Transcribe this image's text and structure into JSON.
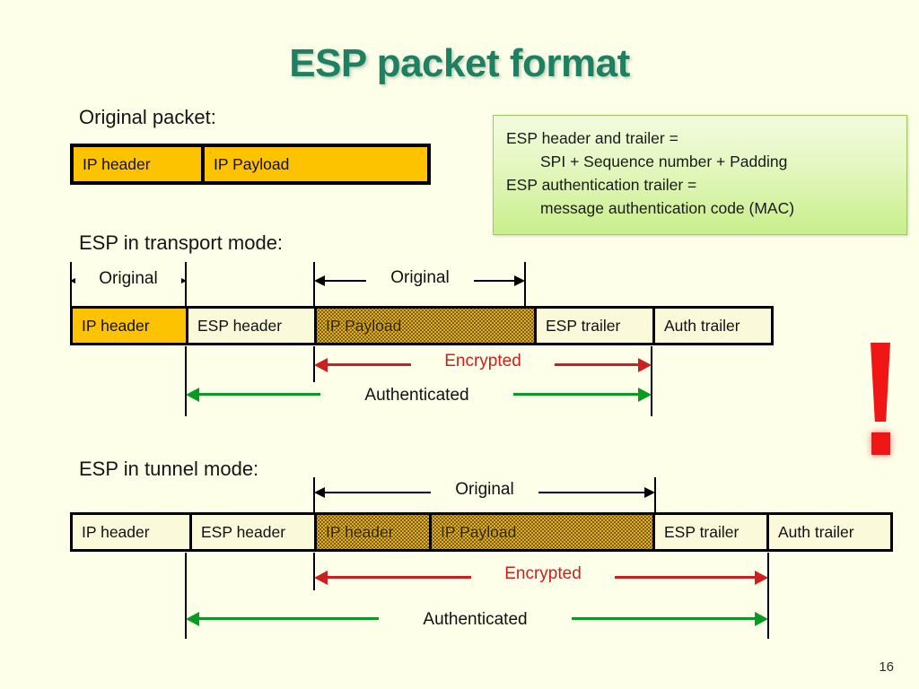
{
  "slide": {
    "title": "ESP packet format",
    "page_number": "16",
    "background_color": "#FDFFE9",
    "title_color": "#1E7F62"
  },
  "legend": {
    "lines": [
      "ESP header and trailer =",
      "SPI + Sequence number + Padding",
      "ESP authentication trailer =",
      "message authentication code (MAC)"
    ],
    "border_color": "#9FCB5E",
    "fill_top": "#F2FBDE",
    "fill_bottom": "#C9EE8C"
  },
  "sections": {
    "original": {
      "caption": "Original packet:",
      "segments": [
        {
          "label": "IP header",
          "style": "solid-yellow"
        },
        {
          "label": "IP Payload",
          "style": "solid-yellow"
        }
      ]
    },
    "transport": {
      "caption": "ESP in transport mode:",
      "segments": [
        {
          "label": "IP header",
          "style": "solid-yellow"
        },
        {
          "label": "ESP header",
          "style": "cream"
        },
        {
          "label": "IP Payload",
          "style": "dotted"
        },
        {
          "label": "ESP trailer",
          "style": "cream"
        },
        {
          "label": "Auth trailer",
          "style": "cream"
        }
      ],
      "spans": [
        {
          "label": "Original",
          "color": "#111111"
        },
        {
          "label": "Original",
          "color": "#111111"
        },
        {
          "label": "Encrypted",
          "color": "#CC2020"
        },
        {
          "label": "Authenticated",
          "color": "#111111"
        }
      ]
    },
    "tunnel": {
      "caption": "ESP in tunnel mode:",
      "segments": [
        {
          "label": "IP header",
          "style": "cream"
        },
        {
          "label": "ESP header",
          "style": "cream"
        },
        {
          "label": "IP header",
          "style": "dotted"
        },
        {
          "label": "IP Payload",
          "style": "dotted"
        },
        {
          "label": "ESP trailer",
          "style": "cream"
        },
        {
          "label": "Auth trailer",
          "style": "cream"
        }
      ],
      "spans": [
        {
          "label": "Original",
          "color": "#111111"
        },
        {
          "label": "Encrypted",
          "color": "#CC2020"
        },
        {
          "label": "Authenticated",
          "color": "#111111"
        }
      ]
    }
  },
  "marker": {
    "exclamation": "!",
    "color": "#F01616"
  }
}
